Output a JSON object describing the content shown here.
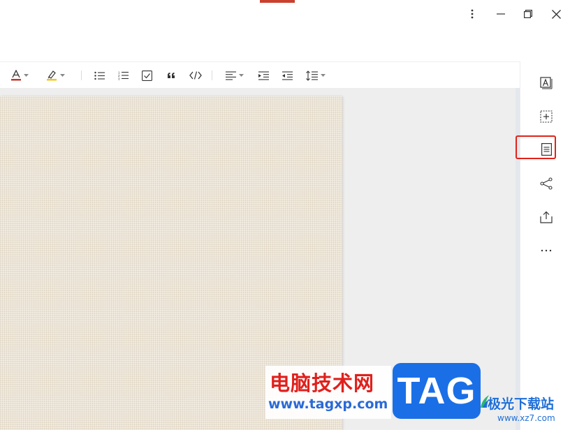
{
  "window": {
    "controls": [
      "more-icon",
      "minimize-icon",
      "restore-icon",
      "close-icon"
    ]
  },
  "toolbar": {
    "items": [
      "font-color-icon",
      "highlight-icon",
      "bullet-list-icon",
      "numbered-list-icon",
      "checkbox-list-icon",
      "quote-icon",
      "code-icon",
      "align-icon",
      "indent-increase-icon",
      "indent-decrease-icon",
      "line-spacing-icon"
    ],
    "font_color": "#c0392b",
    "highlight_color": "#f5c518"
  },
  "right_panel": {
    "items": [
      "text-box-icon",
      "insert-box-icon",
      "page-icon",
      "share-icon",
      "export-icon",
      "more-horizontal-icon"
    ],
    "highlighted_item": "page-icon",
    "highlight_color": "#e0231a"
  },
  "watermark": {
    "cn_title": "电脑技术网",
    "url": "www.tagxp.com",
    "tag": "TAG",
    "site_cn": "极光下载站",
    "site_url": "www.xz7.com"
  }
}
